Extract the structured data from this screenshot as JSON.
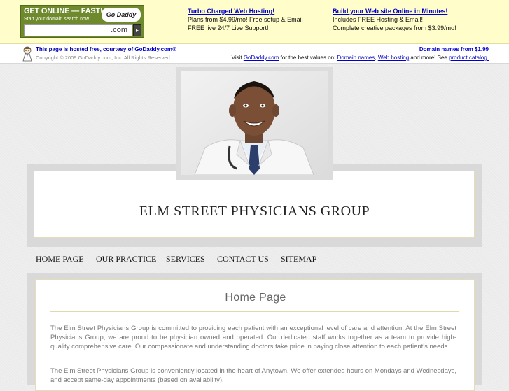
{
  "godaddy_banner": {
    "search_headline": "GET ONLINE — FAST!",
    "search_sub": "Start your domain search now.",
    "logo_text": "Go Daddy",
    "search_placeholder": "",
    "tld": ".com",
    "go_icon": "arrow-right-icon",
    "promo1": {
      "title": "Turbo Charged Web Hosting!",
      "line1": "Plans from $4.99/mo! Free setup & Email",
      "line2": "FREE live 24/7 Live Support!"
    },
    "promo2": {
      "title": "Build your Web site Online in Minutes!",
      "line1": "Includes FREE Hosting & Email!",
      "line2": "Complete creative packages from $3.99/mo!"
    }
  },
  "hosted_strip": {
    "hosted_prefix": "This page is hosted free, courtesy of ",
    "hosted_link": "GoDaddy.com®",
    "copyright": "Copyright © 2009 GoDaddy.com, Inc. All Rights Reserved.",
    "domain_link": "Domain names from $1.99",
    "visit_prefix": "Visit ",
    "visit_link": "GoDaddy.com",
    "visit_mid": " for the best values on: ",
    "link_domains": "Domain names",
    "sep": ", ",
    "link_hosting": "Web hosting",
    "visit_mid2": " and more! See ",
    "link_catalog": "product catalog."
  },
  "site": {
    "title": "ELM STREET PHYSICIANS GROUP"
  },
  "nav": {
    "items": [
      {
        "label": "HOME PAGE"
      },
      {
        "label": "OUR PRACTICE"
      },
      {
        "label": "SERVICES"
      },
      {
        "label": "CONTACT US"
      },
      {
        "label": "SITEMAP"
      }
    ]
  },
  "content": {
    "heading": "Home Page",
    "paragraphs": [
      "The Elm Street Physicians Group is committed to providing each patient with an exceptional level of care and attention. At the Elm Street Physicians Group, we are proud to be physician owned and operated. Our dedicated staff works together as a team to provide high-quality comprehensive care. Our compassionate and understanding doctors take pride in paying close attention to each patient's needs.",
      "The Elm Street Physicians Group is conveniently located in the heart of Anytown. We offer extended hours on Mondays and Wednesdays, and accept same-day appointments (based on availability)."
    ]
  },
  "colors": {
    "banner_bg": "#fffeca",
    "link": "#0000cc",
    "gd_green": "#6f8a2c",
    "frame_gray": "#d9d9d9",
    "gold_rule": "#e3d7ae"
  }
}
